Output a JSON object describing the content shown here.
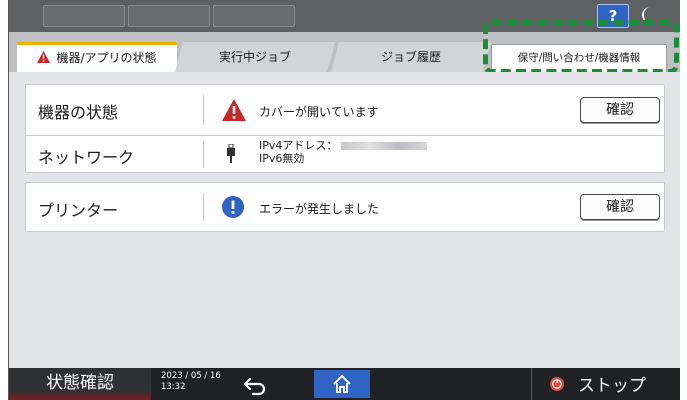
{
  "help": {
    "label": "?"
  },
  "tabs": [
    {
      "label": "機器/アプリの状態"
    },
    {
      "label": "実行中ジョブ"
    },
    {
      "label": "ジョブ履歴"
    },
    {
      "label": "保守/問い合わせ/機器情報"
    }
  ],
  "rows": {
    "device": {
      "label": "機器の状態",
      "message": "カバーが開いています",
      "button": "確認"
    },
    "network": {
      "label": "ネットワーク",
      "ipv4": "IPv4アドレス：",
      "ipv6": "IPv6無効"
    },
    "printer": {
      "label": "プリンター",
      "message": "エラーが発生しました",
      "button": "確認"
    }
  },
  "bottom": {
    "status_button": "状態確認",
    "date": "2023 / 05 / 16",
    "time": "13:32",
    "stop_label": "ストップ"
  },
  "colors": {
    "accent_blue": "#2f63c4",
    "warning_red": "#c8262b",
    "tab_yellow": "#f0b400",
    "highlight_green": "#1a8d3a"
  }
}
